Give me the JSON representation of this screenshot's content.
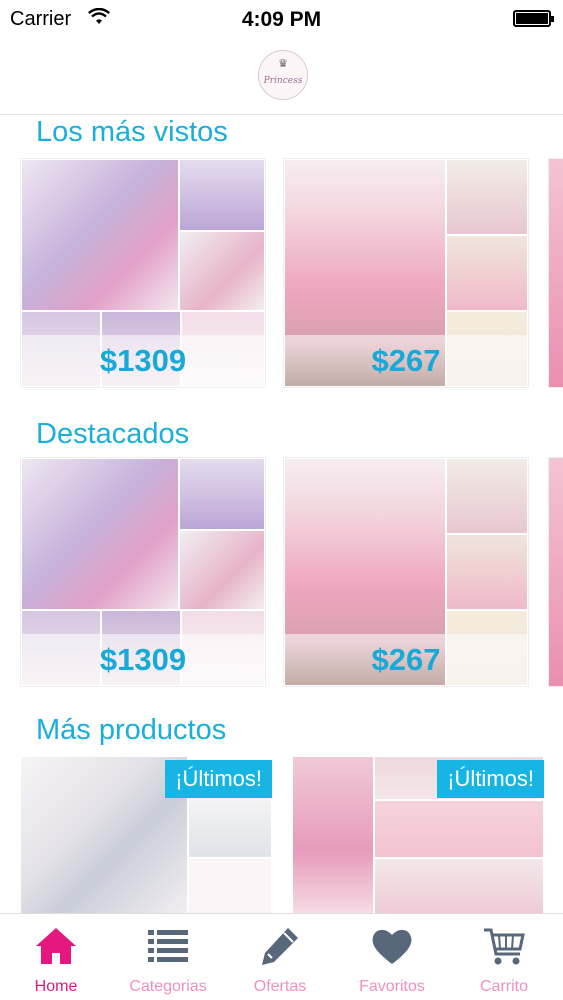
{
  "status_bar": {
    "carrier": "Carrier",
    "time": "4:09 PM"
  },
  "header": {
    "logo_text": "Princess",
    "logo_icon": "crown-icon"
  },
  "sections": {
    "most_viewed": {
      "title": "Los más vistos",
      "items": [
        {
          "price": "$1309"
        },
        {
          "price": "$267"
        }
      ]
    },
    "featured": {
      "title": "Destacados",
      "items": [
        {
          "price": "$1309"
        },
        {
          "price": "$267"
        }
      ]
    },
    "more_products": {
      "title": "Más productos",
      "items": [
        {
          "badge": "¡Últimos!"
        },
        {
          "badge": "¡Últimos!"
        }
      ]
    }
  },
  "tabbar": {
    "items": [
      {
        "label": "Home",
        "icon": "home-icon",
        "active": true
      },
      {
        "label": "Categorias",
        "icon": "list-icon",
        "active": false
      },
      {
        "label": "Ofertas",
        "icon": "pencil-icon",
        "active": false
      },
      {
        "label": "Favoritos",
        "icon": "heart-icon",
        "active": false
      },
      {
        "label": "Carrito",
        "icon": "cart-icon",
        "active": false
      }
    ]
  },
  "colors": {
    "accent": "#17a9d8",
    "active_tab": "#e6177f",
    "inactive_tab": "#f28fc0",
    "tab_icon": "#56687a"
  }
}
